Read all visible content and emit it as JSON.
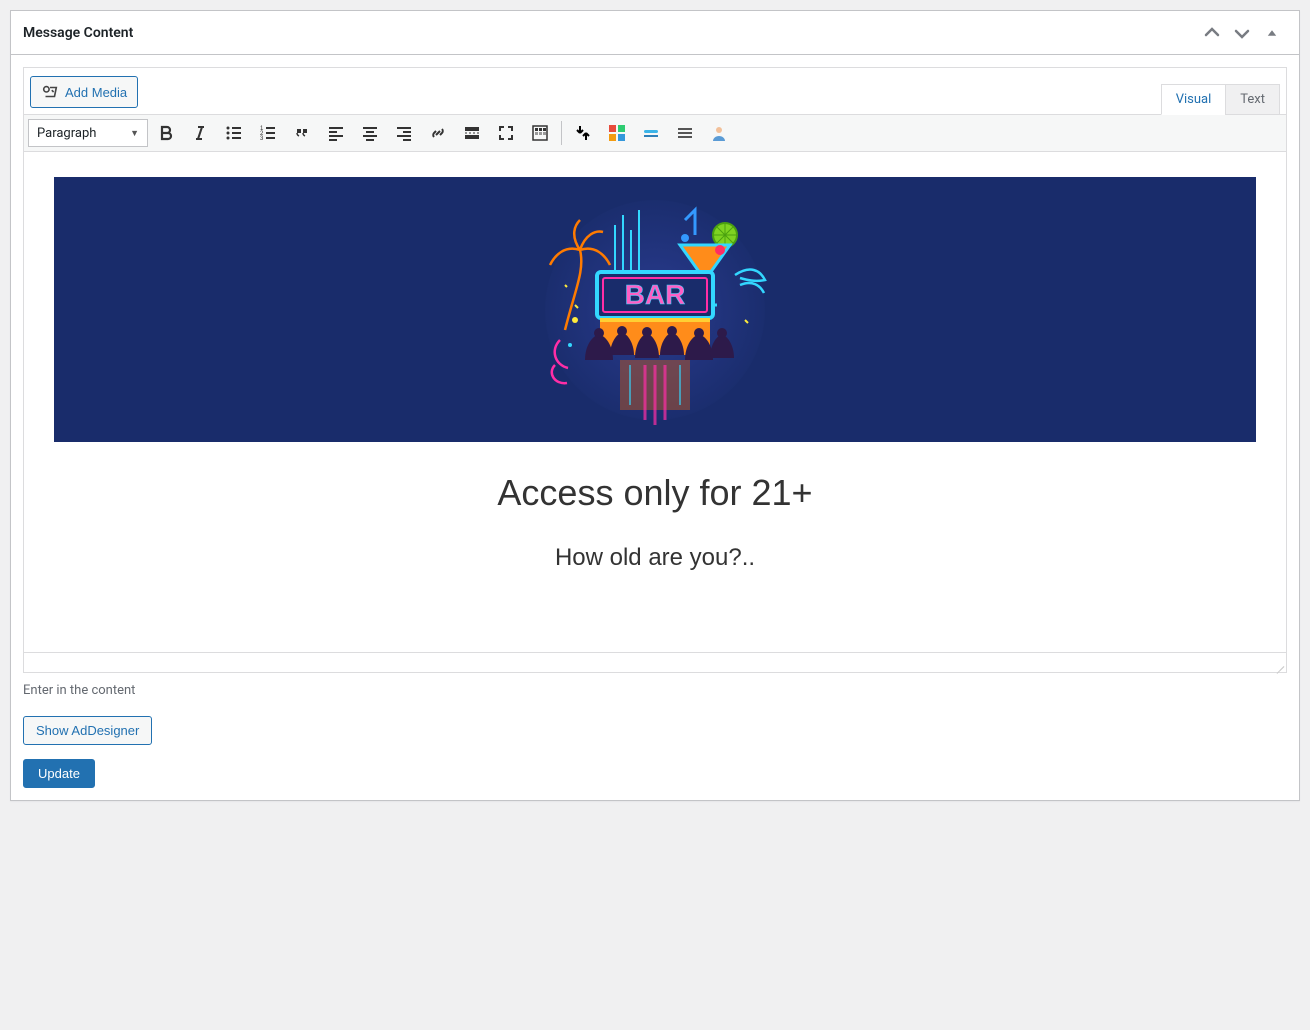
{
  "panel": {
    "title": "Message Content"
  },
  "editor": {
    "add_media_label": "Add Media",
    "tab_visual": "Visual",
    "tab_text": "Text",
    "format_select": "Paragraph",
    "content": {
      "heading": "Access only for 21+",
      "subtext": "How old are you?.."
    },
    "banner_sign_text": "BAR"
  },
  "help_text": "Enter in the content",
  "buttons": {
    "show_addesigner": "Show AdDesigner",
    "update": "Update"
  },
  "icons": {
    "bold": "bold-icon",
    "italic": "italic-icon",
    "ul": "bullet-list-icon",
    "ol": "numbered-list-icon",
    "quote": "blockquote-icon",
    "align_left": "align-left-icon",
    "align_center": "align-center-icon",
    "align_right": "align-right-icon",
    "link": "link-icon",
    "readmore": "read-more-icon",
    "fullscreen": "fullscreen-icon",
    "toolbar_toggle": "toolbar-toggle-icon",
    "insert_down": "insert-icon",
    "color_blocks": "color-palette-icon",
    "hr": "separator-icon",
    "hr2": "separator2-icon",
    "user": "user-icon"
  }
}
